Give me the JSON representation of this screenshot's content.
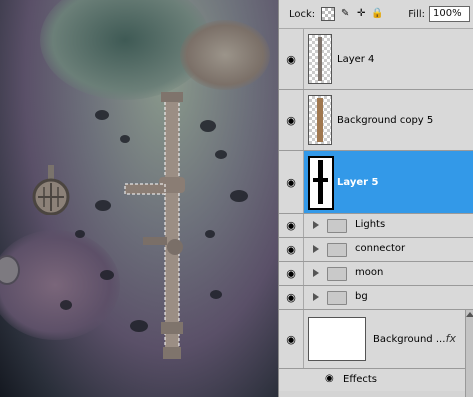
{
  "lock_bar": {
    "lock_label": "Lock:",
    "fill_label": "Fill:",
    "fill_value": "100%"
  },
  "layers": [
    {
      "name": "Layer 4"
    },
    {
      "name": "Background copy 5"
    },
    {
      "name": "Layer 5"
    },
    {
      "name": "Lights"
    },
    {
      "name": "connector"
    },
    {
      "name": "moon"
    },
    {
      "name": "bg"
    },
    {
      "name": "Background ..."
    }
  ],
  "effects_label": "Effects",
  "fx_label": "fx",
  "icons": {
    "eye": "eye-icon",
    "folder": "folder-icon",
    "expand": "expand-triangle-icon"
  }
}
